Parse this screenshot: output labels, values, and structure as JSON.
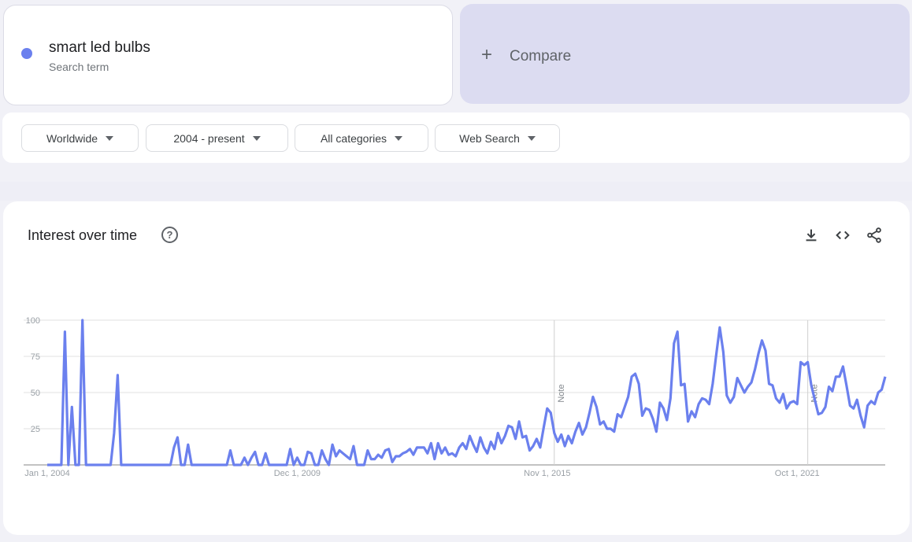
{
  "term": {
    "name": "smart led bulbs",
    "subtitle": "Search term",
    "color": "#6b80ee"
  },
  "compare": {
    "icon": "plus-icon",
    "label": "Compare"
  },
  "filters": [
    {
      "label": "Worldwide"
    },
    {
      "label": "2004 - present"
    },
    {
      "label": "All categories"
    },
    {
      "label": "Web Search"
    }
  ],
  "panel": {
    "title": "Interest over time",
    "help_icon": "help-circle-icon",
    "help_glyph": "?",
    "tools": [
      "download-icon",
      "embed-code-icon",
      "share-icon"
    ]
  },
  "chart_data": {
    "type": "line",
    "title": "Interest over time",
    "xlabel": "",
    "ylabel": "",
    "ylim": [
      0,
      100
    ],
    "yticks": [
      25,
      50,
      75,
      100
    ],
    "ytick_labels": [
      "25",
      "50",
      "75",
      "100"
    ],
    "grid": true,
    "x_start": "2004-01",
    "x_step": "month",
    "xtick_labels": [
      {
        "label": "Jan 1, 2004",
        "index": 0
      },
      {
        "label": "Dec 1, 2009",
        "index": 71
      },
      {
        "label": "Nov 1, 2015",
        "index": 142
      },
      {
        "label": "Oct 1, 2021",
        "index": 213
      }
    ],
    "annotations": [
      {
        "label": "Note",
        "index": 144
      },
      {
        "label": "Note",
        "index": 216
      }
    ],
    "series": [
      {
        "name": "smart led bulbs",
        "color": "#6b80ee",
        "values": [
          0,
          0,
          0,
          0,
          0,
          92,
          0,
          40,
          0,
          0,
          100,
          0,
          0,
          0,
          0,
          0,
          0,
          0,
          0,
          22,
          62,
          0,
          0,
          0,
          0,
          0,
          0,
          0,
          0,
          0,
          0,
          0,
          0,
          0,
          0,
          0,
          12,
          19,
          0,
          0,
          14,
          0,
          0,
          0,
          0,
          0,
          0,
          0,
          0,
          0,
          0,
          0,
          10,
          0,
          0,
          0,
          5,
          0,
          5,
          9,
          0,
          0,
          8,
          0,
          0,
          0,
          0,
          0,
          0,
          11,
          0,
          5,
          0,
          0,
          9,
          8,
          0,
          0,
          10,
          4,
          0,
          14,
          6,
          10,
          8,
          6,
          4,
          13,
          0,
          0,
          0,
          10,
          4,
          4,
          7,
          5,
          10,
          11,
          2,
          6,
          6,
          8,
          9,
          11,
          7,
          12,
          12,
          12,
          8,
          15,
          4,
          15,
          8,
          12,
          7,
          8,
          6,
          12,
          15,
          11,
          20,
          14,
          9,
          19,
          12,
          8,
          16,
          11,
          22,
          15,
          20,
          27,
          26,
          18,
          30,
          19,
          20,
          10,
          13,
          18,
          12,
          26,
          39,
          36,
          22,
          16,
          21,
          13,
          20,
          15,
          23,
          29,
          21,
          26,
          36,
          47,
          40,
          28,
          30,
          25,
          25,
          23,
          35,
          33,
          40,
          47,
          61,
          63,
          56,
          34,
          39,
          38,
          32,
          23,
          43,
          39,
          31,
          46,
          84,
          92,
          55,
          56,
          30,
          37,
          33,
          42,
          46,
          45,
          42,
          56,
          76,
          95,
          78,
          48,
          43,
          47,
          60,
          55,
          50,
          54,
          57,
          66,
          77,
          86,
          79,
          56,
          55,
          46,
          43,
          49,
          39,
          43,
          44,
          42,
          71,
          69,
          71,
          55,
          45,
          35,
          36,
          40,
          54,
          51,
          61,
          61,
          68,
          55,
          41,
          39,
          45,
          34,
          26,
          41,
          44,
          42,
          50,
          52,
          61
        ]
      }
    ]
  }
}
